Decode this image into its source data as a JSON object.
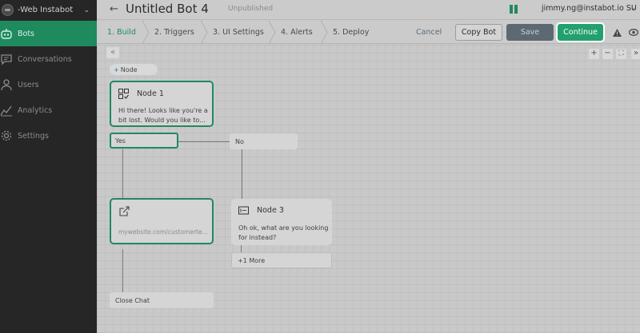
{
  "workspace": {
    "name": "-Web Instabot"
  },
  "sidebar": {
    "items": [
      {
        "label": "Bots",
        "icon": "robot-icon"
      },
      {
        "label": "Conversations",
        "icon": "chat-icon"
      },
      {
        "label": "Users",
        "icon": "user-icon"
      },
      {
        "label": "Analytics",
        "icon": "chart-icon"
      },
      {
        "label": "Settings",
        "icon": "gear-icon"
      }
    ]
  },
  "header": {
    "title": "Untitled Bot 4",
    "status": "Unpublished",
    "user": "jimmy.ng@instabot.io SU"
  },
  "steps": [
    "1. Build",
    "2. Triggers",
    "3. UI Settings",
    "4. Alerts",
    "5. Deploy"
  ],
  "actions": {
    "cancel": "Cancel",
    "copy": "Copy Bot",
    "save": "Save",
    "continue": "Continue"
  },
  "canvas": {
    "collapse": "«",
    "add_node": "Node",
    "zoom_in": "+",
    "zoom_out": "−",
    "fit": "⛶",
    "expand": "»",
    "node1": {
      "title": "Node 1",
      "text_line1": "Hi there! Looks like you're a",
      "text_line2": "bit lost. Would you like to..."
    },
    "option_yes": "Yes",
    "option_no": "No",
    "link_node": {
      "url": "mywebsite.com/customerte..."
    },
    "node3": {
      "title": "Node 3",
      "text_line1": "Oh ok, what are you looking",
      "text_line2": "for instead?"
    },
    "more": "+1 More",
    "close_chat": "Close Chat"
  },
  "colors": {
    "accent": "#1f8a5e",
    "continue": "#23a06e",
    "save": "#5d6972"
  }
}
